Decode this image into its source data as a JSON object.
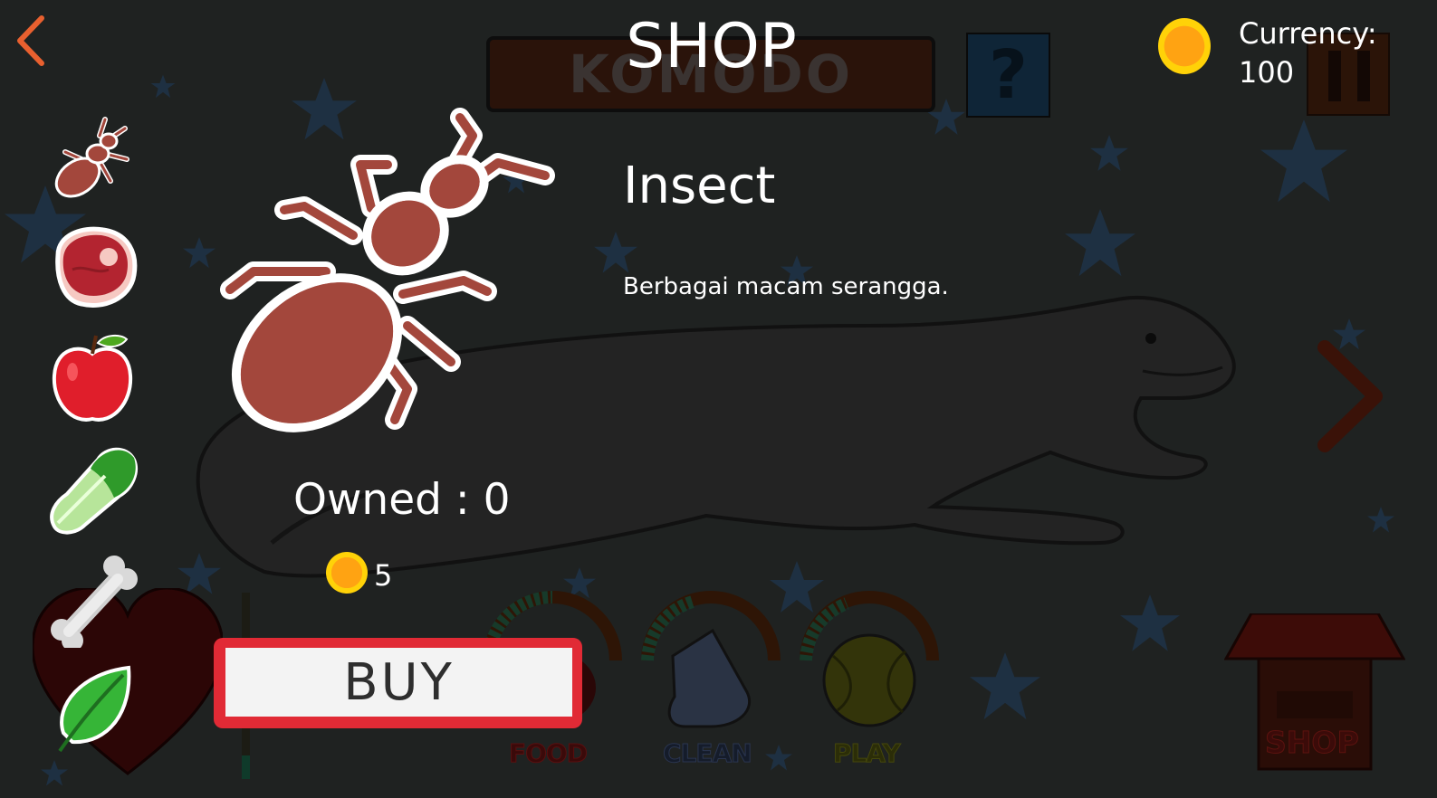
{
  "screen": {
    "title": "SHOP",
    "pet_name": "KOMODO",
    "help_symbol": "?"
  },
  "currency": {
    "label": "Currency:",
    "value": "100",
    "icon": "coin-icon"
  },
  "categories": [
    {
      "name": "Insect",
      "icon": "insect-icon",
      "selected": true
    },
    {
      "name": "Meat",
      "icon": "meat-icon",
      "selected": false
    },
    {
      "name": "Apple",
      "icon": "apple-icon",
      "selected": false
    },
    {
      "name": "Lettuce",
      "icon": "lettuce-icon",
      "selected": false
    },
    {
      "name": "Bone",
      "icon": "bone-icon",
      "selected": false
    },
    {
      "name": "Leaf",
      "icon": "leaf-icon",
      "selected": false
    }
  ],
  "item": {
    "name": "Insect",
    "description": "Berbagai macam serangga.",
    "owned_text": "Owned : 0",
    "price": "5",
    "buy_label": "BUY"
  },
  "stats": {
    "food_label": "FOOD",
    "clean_label": "CLEAN",
    "play_label": "PLAY",
    "food_level": 0.3,
    "clean_level": 0.3,
    "play_level": 0.3
  },
  "shop_building_label": "SHOP",
  "colors": {
    "buy_border": "#e12a35",
    "coin": "#ffb30f",
    "insect": "#a3473c",
    "arrow": "#e8602f"
  }
}
